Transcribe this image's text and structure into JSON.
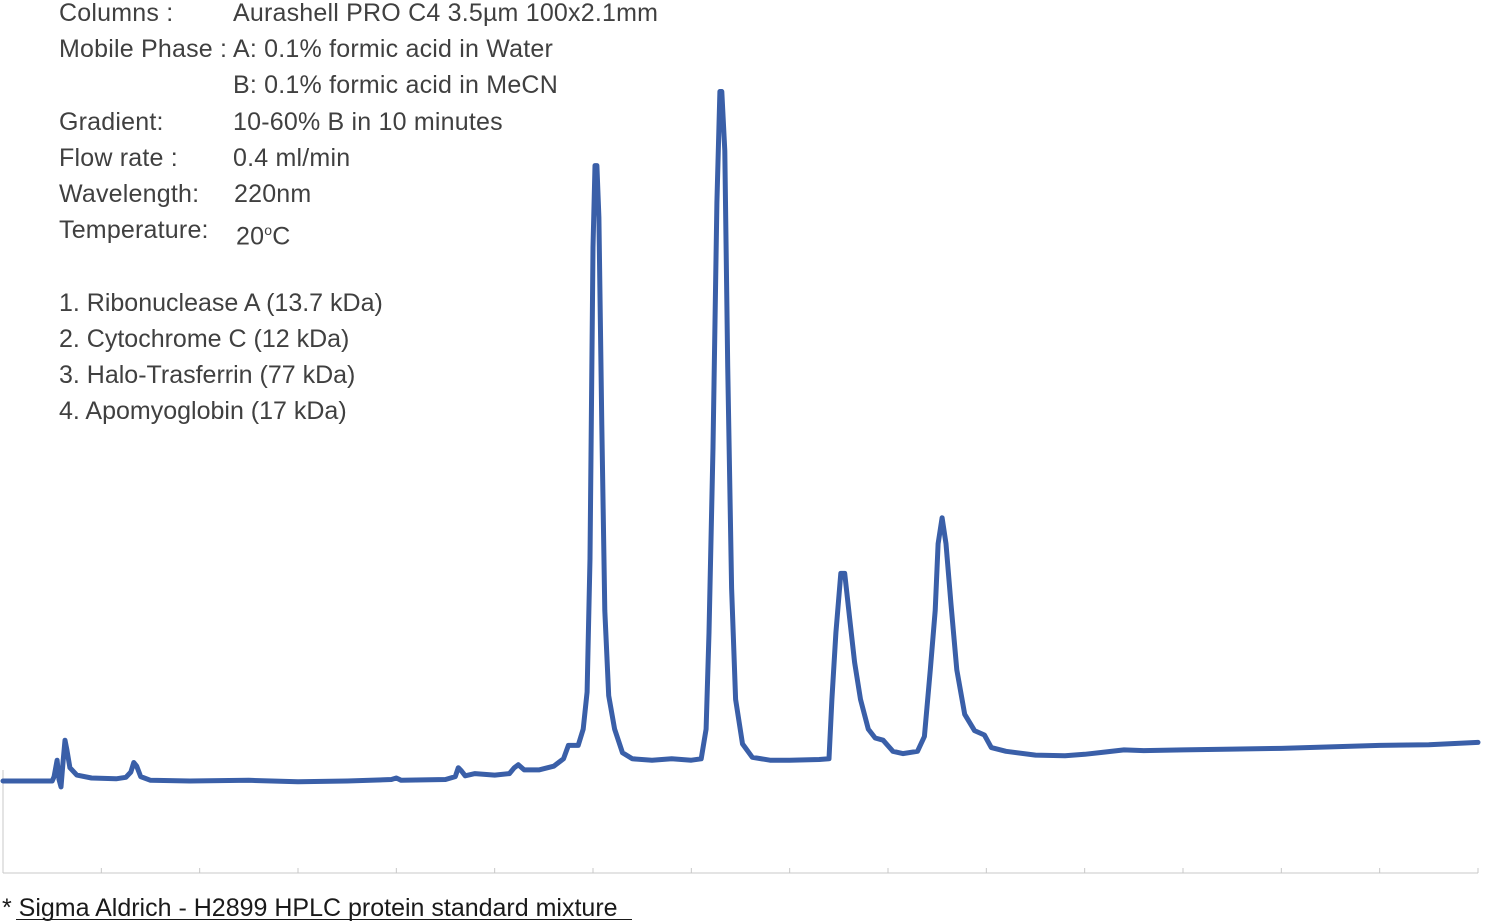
{
  "conditions": {
    "columns": {
      "label": "Columns :",
      "value": "Aurashell PRO C4 3.5µm 100x2.1mm"
    },
    "mobile_phase": {
      "label": "Mobile Phase :",
      "value_a": "A:   0.1% formic acid in Water",
      "value_b": "B:  0.1% formic acid in MeCN"
    },
    "gradient": {
      "label": "Gradient:",
      "value": "10-60% B in 10 minutes"
    },
    "flow_rate": {
      "label": "Flow rate :",
      "value": "0.4 ml/min"
    },
    "wavelength": {
      "label": "Wavelength:",
      "value": "220nm"
    },
    "temperature": {
      "label": "Temperature:",
      "value_num": "20",
      "value_sup": "o",
      "value_unit": "C"
    }
  },
  "legend": {
    "items": [
      "1. Ribonuclease A (13.7 kDa)",
      "2. Cytochrome C  (12 kDa)",
      "3. Halo-Trasferrin (77 kDa)",
      "4. Apomyoglobin  (17 kDa)"
    ]
  },
  "footnote": "* Sigma Aldrich - H2899 HPLC protein standard mixture",
  "colors": {
    "trace": "#3a5fa8",
    "axis": "#c8c8c8",
    "text": "#404040"
  },
  "chart_data": {
    "type": "line",
    "title": "",
    "xlabel": "",
    "ylabel": "",
    "xlim": [
      0,
      15
    ],
    "ylim": [
      -50,
      1000
    ],
    "grid": false,
    "legend_placement": "none",
    "x_tick_count": 15,
    "series": [
      {
        "color": "#3a5fa8",
        "points": [
          [
            0.0,
            0
          ],
          [
            0.5,
            0
          ],
          [
            0.52,
            6
          ],
          [
            0.55,
            28
          ],
          [
            0.57,
            2
          ],
          [
            0.59,
            -8
          ],
          [
            0.61,
            25
          ],
          [
            0.63,
            55
          ],
          [
            0.65,
            42
          ],
          [
            0.68,
            18
          ],
          [
            0.75,
            8
          ],
          [
            0.9,
            4
          ],
          [
            1.15,
            3
          ],
          [
            1.25,
            5
          ],
          [
            1.3,
            12
          ],
          [
            1.33,
            25
          ],
          [
            1.36,
            20
          ],
          [
            1.4,
            6
          ],
          [
            1.5,
            1
          ],
          [
            1.9,
            0
          ],
          [
            2.5,
            1
          ],
          [
            3.0,
            -1
          ],
          [
            3.5,
            0
          ],
          [
            3.95,
            2
          ],
          [
            4.0,
            4
          ],
          [
            4.05,
            1
          ],
          [
            4.5,
            2
          ],
          [
            4.6,
            6
          ],
          [
            4.63,
            18
          ],
          [
            4.66,
            14
          ],
          [
            4.7,
            7
          ],
          [
            4.8,
            10
          ],
          [
            5.0,
            8
          ],
          [
            5.15,
            10
          ],
          [
            5.2,
            18
          ],
          [
            5.24,
            22
          ],
          [
            5.3,
            15
          ],
          [
            5.45,
            15
          ],
          [
            5.6,
            20
          ],
          [
            5.7,
            30
          ],
          [
            5.75,
            48
          ],
          [
            5.85,
            48
          ],
          [
            5.9,
            70
          ],
          [
            5.94,
            120
          ],
          [
            5.97,
            300
          ],
          [
            6.0,
            720
          ],
          [
            6.02,
            830
          ],
          [
            6.04,
            830
          ],
          [
            6.06,
            760
          ],
          [
            6.09,
            480
          ],
          [
            6.12,
            230
          ],
          [
            6.16,
            115
          ],
          [
            6.22,
            70
          ],
          [
            6.3,
            38
          ],
          [
            6.4,
            30
          ],
          [
            6.6,
            28
          ],
          [
            6.8,
            30
          ],
          [
            7.0,
            28
          ],
          [
            7.1,
            30
          ],
          [
            7.15,
            70
          ],
          [
            7.18,
            200
          ],
          [
            7.22,
            450
          ],
          [
            7.26,
            780
          ],
          [
            7.29,
            930
          ],
          [
            7.31,
            930
          ],
          [
            7.34,
            850
          ],
          [
            7.37,
            560
          ],
          [
            7.41,
            260
          ],
          [
            7.45,
            110
          ],
          [
            7.52,
            50
          ],
          [
            7.62,
            32
          ],
          [
            7.8,
            28
          ],
          [
            8.0,
            28
          ],
          [
            8.3,
            29
          ],
          [
            8.4,
            30
          ],
          [
            8.43,
            110
          ],
          [
            8.47,
            200
          ],
          [
            8.52,
            280
          ],
          [
            8.56,
            280
          ],
          [
            8.61,
            220
          ],
          [
            8.66,
            160
          ],
          [
            8.72,
            110
          ],
          [
            8.8,
            70
          ],
          [
            8.87,
            58
          ],
          [
            8.95,
            55
          ],
          [
            9.05,
            40
          ],
          [
            9.15,
            37
          ],
          [
            9.3,
            40
          ],
          [
            9.37,
            60
          ],
          [
            9.43,
            150
          ],
          [
            9.48,
            230
          ],
          [
            9.51,
            320
          ],
          [
            9.55,
            355
          ],
          [
            9.59,
            320
          ],
          [
            9.64,
            240
          ],
          [
            9.7,
            150
          ],
          [
            9.78,
            90
          ],
          [
            9.88,
            68
          ],
          [
            9.98,
            62
          ],
          [
            10.05,
            45
          ],
          [
            10.2,
            40
          ],
          [
            10.5,
            35
          ],
          [
            10.8,
            34
          ],
          [
            11.0,
            36
          ],
          [
            11.2,
            39
          ],
          [
            11.4,
            42
          ],
          [
            11.6,
            41
          ],
          [
            12.0,
            42
          ],
          [
            12.5,
            43
          ],
          [
            13.0,
            44
          ],
          [
            13.5,
            46
          ],
          [
            14.0,
            48
          ],
          [
            14.5,
            49
          ],
          [
            15.0,
            52
          ]
        ]
      }
    ]
  }
}
